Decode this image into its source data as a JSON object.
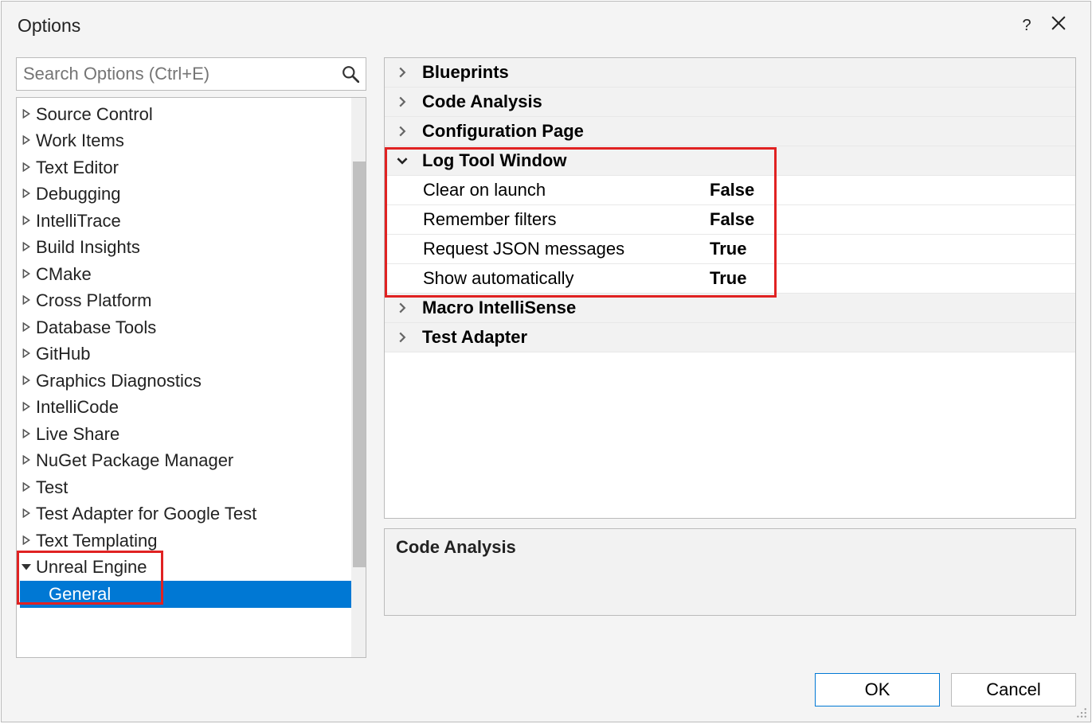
{
  "dialog": {
    "title": "Options",
    "help_tooltip": "?",
    "close_tooltip": "Close"
  },
  "search": {
    "placeholder": "Search Options (Ctrl+E)"
  },
  "tree": {
    "items": [
      {
        "label": "Source Control",
        "expanded": false,
        "level": 0
      },
      {
        "label": "Work Items",
        "expanded": false,
        "level": 0
      },
      {
        "label": "Text Editor",
        "expanded": false,
        "level": 0
      },
      {
        "label": "Debugging",
        "expanded": false,
        "level": 0
      },
      {
        "label": "IntelliTrace",
        "expanded": false,
        "level": 0
      },
      {
        "label": "Build Insights",
        "expanded": false,
        "level": 0
      },
      {
        "label": "CMake",
        "expanded": false,
        "level": 0
      },
      {
        "label": "Cross Platform",
        "expanded": false,
        "level": 0
      },
      {
        "label": "Database Tools",
        "expanded": false,
        "level": 0
      },
      {
        "label": "GitHub",
        "expanded": false,
        "level": 0
      },
      {
        "label": "Graphics Diagnostics",
        "expanded": false,
        "level": 0
      },
      {
        "label": "IntelliCode",
        "expanded": false,
        "level": 0
      },
      {
        "label": "Live Share",
        "expanded": false,
        "level": 0
      },
      {
        "label": "NuGet Package Manager",
        "expanded": false,
        "level": 0
      },
      {
        "label": "Test",
        "expanded": false,
        "level": 0
      },
      {
        "label": "Test Adapter for Google Test",
        "expanded": false,
        "level": 0
      },
      {
        "label": "Text Templating",
        "expanded": false,
        "level": 0
      },
      {
        "label": "Unreal Engine",
        "expanded": true,
        "level": 0
      },
      {
        "label": "General",
        "expanded": null,
        "level": 1,
        "selected": true
      }
    ]
  },
  "propgrid": {
    "categories": [
      {
        "label": "Blueprints",
        "expanded": false,
        "items": []
      },
      {
        "label": "Code Analysis",
        "expanded": false,
        "items": []
      },
      {
        "label": "Configuration Page",
        "expanded": false,
        "items": []
      },
      {
        "label": "Log Tool Window",
        "expanded": true,
        "items": [
          {
            "label": "Clear on launch",
            "value": "False"
          },
          {
            "label": "Remember filters",
            "value": "False"
          },
          {
            "label": "Request JSON messages",
            "value": "True"
          },
          {
            "label": "Show automatically",
            "value": "True"
          }
        ]
      },
      {
        "label": "Macro IntelliSense",
        "expanded": false,
        "items": []
      },
      {
        "label": "Test Adapter",
        "expanded": false,
        "items": []
      }
    ]
  },
  "description": {
    "title": "Code Analysis"
  },
  "buttons": {
    "ok": "OK",
    "cancel": "Cancel"
  }
}
